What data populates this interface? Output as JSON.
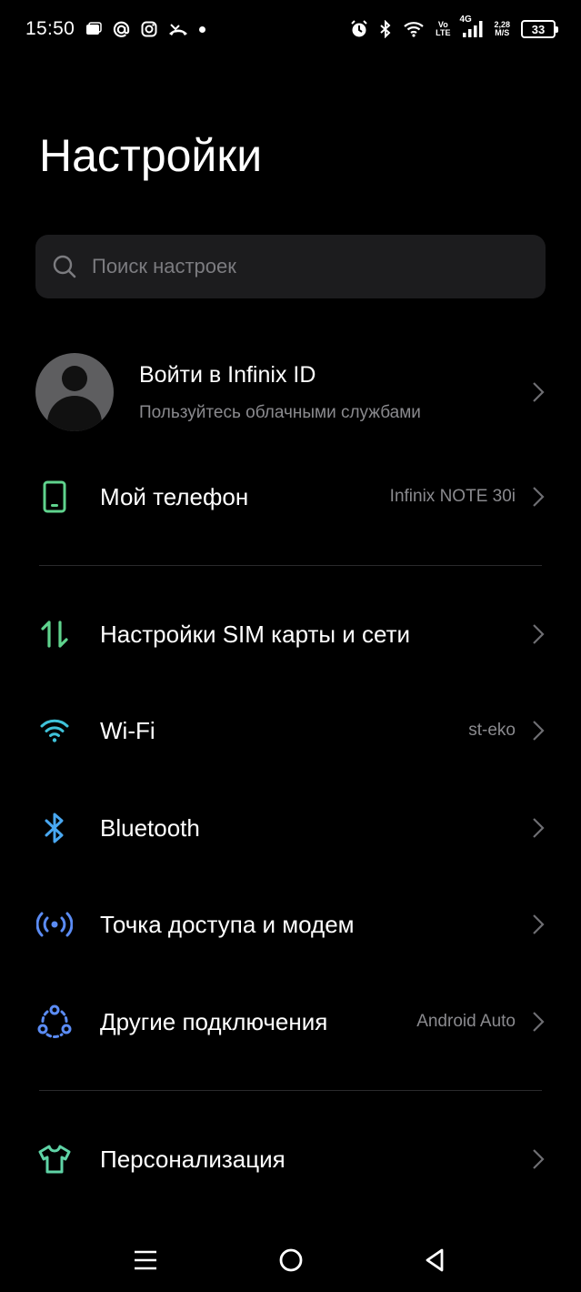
{
  "status_bar": {
    "time": "15:50",
    "left_icons": [
      "image-notification-icon",
      "at-sign-icon",
      "instagram-icon",
      "missed-call-icon",
      "dot-icon"
    ],
    "volte_top": "Vo",
    "volte_bottom": "LTE",
    "network_type": "4G",
    "speed_top": "2,28",
    "speed_bottom": "M/S",
    "battery": "33"
  },
  "header": {
    "title": "Настройки"
  },
  "search": {
    "placeholder": "Поиск настроек"
  },
  "account": {
    "title": "Войти в Infinix ID",
    "subtitle": "Пользуйтесь облачными службами"
  },
  "items": [
    {
      "label": "Мой телефон",
      "value": "Infinix NOTE 30i",
      "icon": "phone-icon",
      "color": "#5fd38d"
    },
    {
      "label": "Настройки SIM карты и сети",
      "value": "",
      "icon": "data-arrows-icon",
      "color": "#5fd38d"
    },
    {
      "label": "Wi-Fi",
      "value": "st-eko",
      "icon": "wifi-icon",
      "color": "#3fc2d9"
    },
    {
      "label": "Bluetooth",
      "value": "",
      "icon": "bluetooth-icon",
      "color": "#49a8f2"
    },
    {
      "label": "Точка доступа и модем",
      "value": "",
      "icon": "hotspot-icon",
      "color": "#5b8cf5"
    },
    {
      "label": "Другие подключения",
      "value": "Android Auto",
      "icon": "connections-icon",
      "color": "#5b8cf5"
    },
    {
      "label": "Персонализация",
      "value": "",
      "icon": "tshirt-icon",
      "color": "#5fd3a6"
    }
  ],
  "nav": {
    "buttons": [
      "menu-icon",
      "home-icon",
      "back-icon"
    ]
  }
}
